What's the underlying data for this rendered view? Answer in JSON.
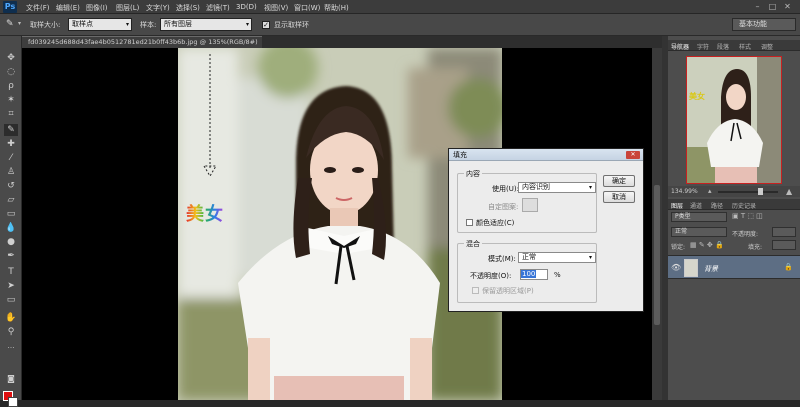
{
  "app": {
    "logo": "Ps"
  },
  "menu": [
    "文件(F)",
    "编辑(E)",
    "图像(I)",
    "图层(L)",
    "文字(Y)",
    "选择(S)",
    "滤镜(T)",
    "3D(D)",
    "视图(V)",
    "窗口(W)",
    "帮助(H)"
  ],
  "options": {
    "brush_size_label": "取样大小:",
    "brush_size_value": "取样点",
    "sample_label": "样本:",
    "sample_value": "所有图层",
    "show_ring_label": "显示取样环",
    "workspace": "基本功能"
  },
  "document": {
    "tab_title": "fd039245d688d43fae4b0512781ed21b0ff43b6b.jpg @ 135%(RGB/8#) *",
    "overlay_text": "美女"
  },
  "right_panel": {
    "top_tabs": [
      "导航器",
      "字符",
      "段落",
      "样式",
      "调整"
    ],
    "zoom": "134.99%",
    "layer_tabs": [
      "图层",
      "通道",
      "路径",
      "历史记录"
    ],
    "kind_filter": "P类型",
    "blend_mode": "正常",
    "opacity_label": "不透明度:",
    "lock_label": "锁定:",
    "fill_label": "填充:",
    "layer_name": "背景"
  },
  "dialog": {
    "title": "填充",
    "contents_group": "内容",
    "use_label": "使用(U):",
    "use_value": "内容识别",
    "custom_pattern_label": "自定图案:",
    "color_adapt_label": "颜色适应(C)",
    "blending_group": "混合",
    "mode_label": "模式(M):",
    "mode_value": "正常",
    "opacity_label": "不透明度(O):",
    "opacity_value": "100",
    "opacity_unit": "%",
    "preserve_label": "保留透明区域(P)",
    "ok": "确定",
    "cancel": "取消"
  },
  "colors": {
    "foreground": "#e01010",
    "background": "#ffffff",
    "accent": "#5d6e84"
  }
}
